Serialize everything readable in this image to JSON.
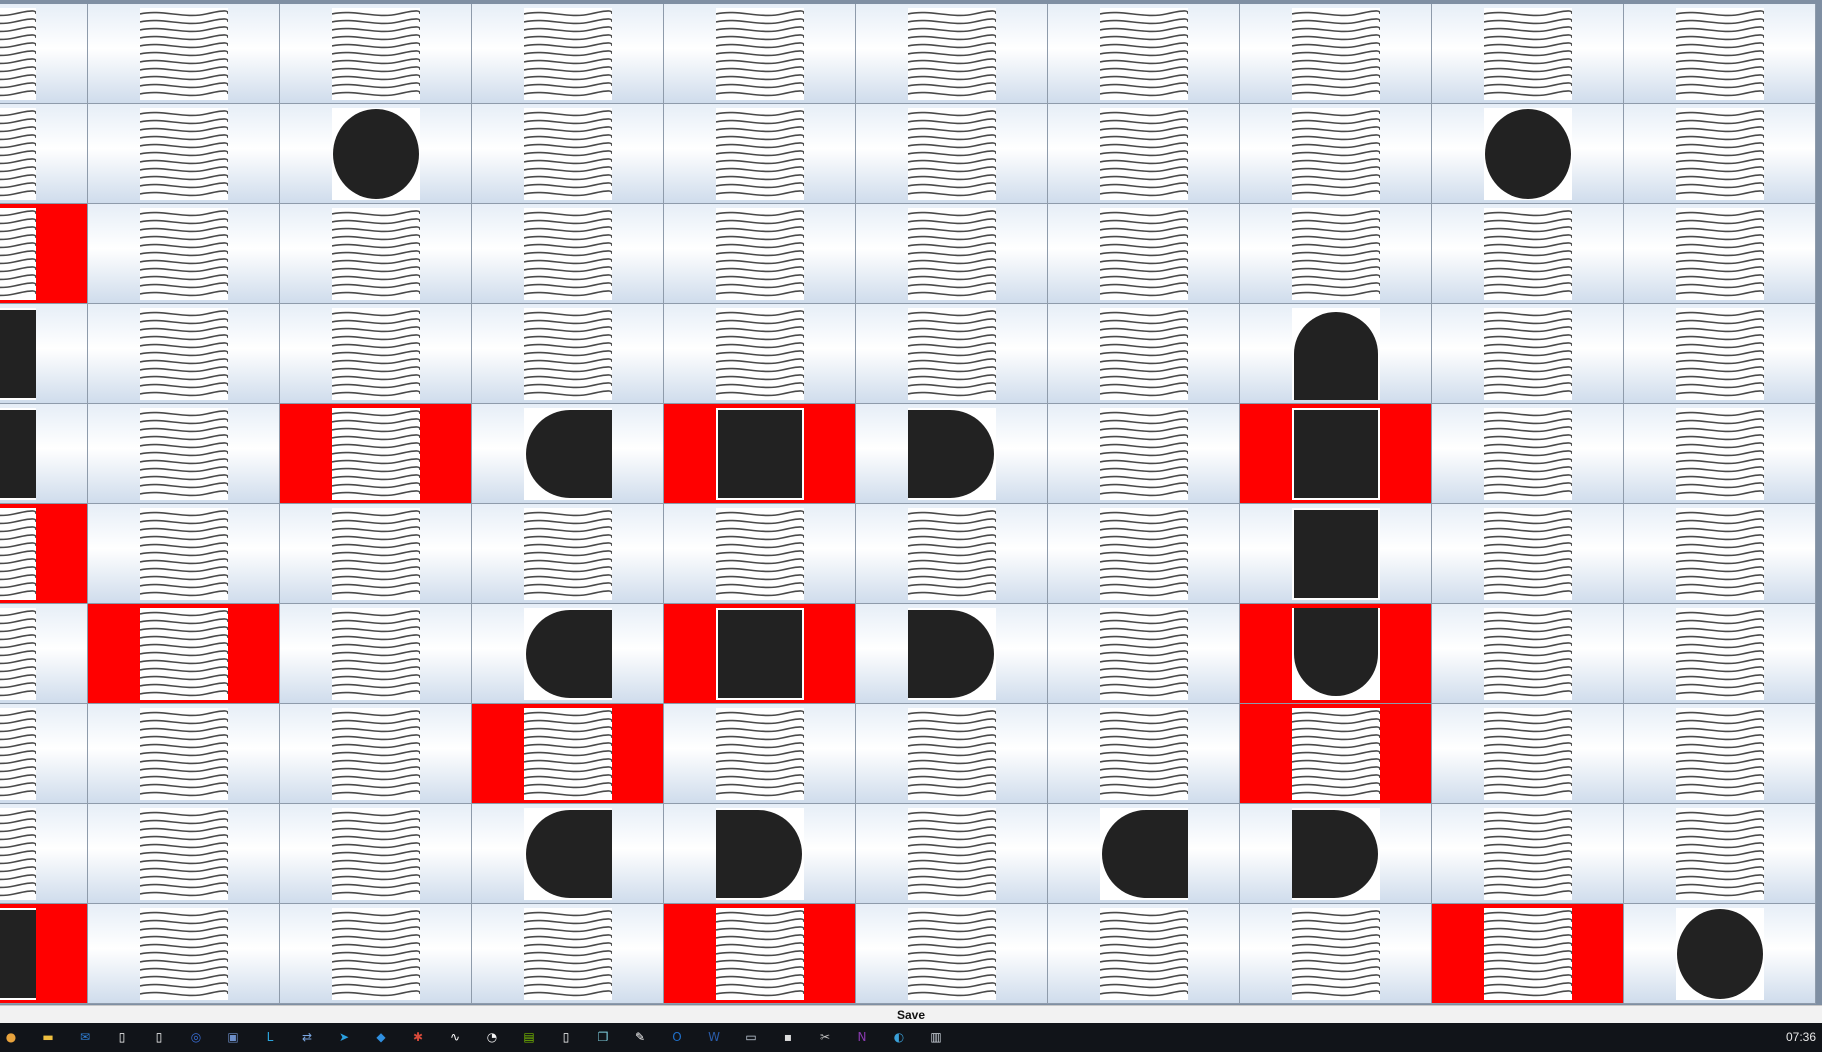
{
  "board": {
    "rows": [
      [
        {
          "t": "wave"
        },
        {
          "t": "wave"
        },
        {
          "t": "wave"
        },
        {
          "t": "wave"
        },
        {
          "t": "wave"
        },
        {
          "t": "wave"
        },
        {
          "t": "wave"
        },
        {
          "t": "wave"
        },
        {
          "t": "wave"
        },
        {
          "t": "wave"
        }
      ],
      [
        {
          "t": "wave"
        },
        {
          "t": "wave"
        },
        {
          "t": "circle"
        },
        {
          "t": "wave"
        },
        {
          "t": "wave"
        },
        {
          "t": "wave"
        },
        {
          "t": "wave"
        },
        {
          "t": "wave"
        },
        {
          "t": "circle"
        },
        {
          "t": "wave"
        }
      ],
      [
        {
          "t": "wave",
          "m": true
        },
        {
          "t": "wave"
        },
        {
          "t": "wave"
        },
        {
          "t": "wave"
        },
        {
          "t": "wave"
        },
        {
          "t": "wave"
        },
        {
          "t": "wave"
        },
        {
          "t": "wave"
        },
        {
          "t": "wave"
        },
        {
          "t": "wave"
        }
      ],
      [
        {
          "t": "cap-left"
        },
        {
          "t": "wave"
        },
        {
          "t": "wave"
        },
        {
          "t": "wave"
        },
        {
          "t": "wave"
        },
        {
          "t": "wave"
        },
        {
          "t": "wave"
        },
        {
          "t": "cap-up"
        },
        {
          "t": "wave"
        },
        {
          "t": "wave"
        }
      ],
      [
        {
          "t": "cap-left"
        },
        {
          "t": "wave"
        },
        {
          "t": "wave",
          "m": true
        },
        {
          "t": "cap-left"
        },
        {
          "t": "square",
          "m": true
        },
        {
          "t": "cap-right"
        },
        {
          "t": "wave"
        },
        {
          "t": "square",
          "m": true
        },
        {
          "t": "wave"
        },
        {
          "t": "wave"
        }
      ],
      [
        {
          "t": "wave",
          "m": true
        },
        {
          "t": "wave"
        },
        {
          "t": "wave"
        },
        {
          "t": "wave"
        },
        {
          "t": "wave"
        },
        {
          "t": "wave"
        },
        {
          "t": "wave"
        },
        {
          "t": "square"
        },
        {
          "t": "wave"
        },
        {
          "t": "wave"
        }
      ],
      [
        {
          "t": "wave"
        },
        {
          "t": "wave",
          "m": true
        },
        {
          "t": "wave"
        },
        {
          "t": "cap-left"
        },
        {
          "t": "square",
          "m": true
        },
        {
          "t": "cap-right"
        },
        {
          "t": "wave"
        },
        {
          "t": "cap-down",
          "m": true
        },
        {
          "t": "wave"
        },
        {
          "t": "wave"
        }
      ],
      [
        {
          "t": "wave"
        },
        {
          "t": "wave"
        },
        {
          "t": "wave"
        },
        {
          "t": "wave",
          "m": true
        },
        {
          "t": "wave"
        },
        {
          "t": "wave"
        },
        {
          "t": "wave"
        },
        {
          "t": "wave",
          "m": true
        },
        {
          "t": "wave"
        },
        {
          "t": "wave"
        }
      ],
      [
        {
          "t": "wave"
        },
        {
          "t": "wave"
        },
        {
          "t": "wave"
        },
        {
          "t": "cap-left"
        },
        {
          "t": "cap-right"
        },
        {
          "t": "wave"
        },
        {
          "t": "cap-left"
        },
        {
          "t": "cap-right"
        },
        {
          "t": "wave"
        },
        {
          "t": "wave"
        }
      ],
      [
        {
          "t": "cap-left",
          "m": true
        },
        {
          "t": "wave"
        },
        {
          "t": "wave"
        },
        {
          "t": "wave"
        },
        {
          "t": "wave",
          "m": true
        },
        {
          "t": "wave"
        },
        {
          "t": "wave"
        },
        {
          "t": "wave"
        },
        {
          "t": "wave",
          "m": true
        },
        {
          "t": "circle"
        }
      ]
    ]
  },
  "save_bar": {
    "label": "Save"
  },
  "taskbar": {
    "icons": [
      {
        "name": "chrome-icon",
        "color": "#e8a33d",
        "glyph": "●"
      },
      {
        "name": "file-explorer-icon",
        "color": "#f0c040",
        "glyph": "▬"
      },
      {
        "name": "mail-icon",
        "color": "#2f7fd6",
        "glyph": "✉"
      },
      {
        "name": "document-icon",
        "color": "#ffffff",
        "glyph": "▯"
      },
      {
        "name": "document-icon",
        "color": "#ffffff",
        "glyph": "▯"
      },
      {
        "name": "chat-icon",
        "color": "#3a6fd8",
        "glyph": "◎"
      },
      {
        "name": "remote-desktop-icon",
        "color": "#6d8fc9",
        "glyph": "▣"
      },
      {
        "name": "app-l-icon",
        "color": "#2aa4dc",
        "glyph": "L"
      },
      {
        "name": "network-icon",
        "color": "#7aa6e0",
        "glyph": "⇄"
      },
      {
        "name": "telegram-icon",
        "color": "#2aa0e0",
        "glyph": "➤"
      },
      {
        "name": "vscode-icon",
        "color": "#2f8fe0",
        "glyph": "◆"
      },
      {
        "name": "bug-icon",
        "color": "#d84a3a",
        "glyph": "✱"
      },
      {
        "name": "wave-app-icon",
        "color": "#ffffff",
        "glyph": "∿"
      },
      {
        "name": "clock-app-icon",
        "color": "#f5f5f5",
        "glyph": "◔"
      },
      {
        "name": "nvidia-icon",
        "color": "#76b900",
        "glyph": "▤"
      },
      {
        "name": "notepad-icon",
        "color": "#ffffff",
        "glyph": "▯"
      },
      {
        "name": "files-icon",
        "color": "#7fd0e0",
        "glyph": "❐"
      },
      {
        "name": "edit-icon",
        "color": "#ffffff",
        "glyph": "✎"
      },
      {
        "name": "outlook-icon",
        "color": "#1f6fc8",
        "glyph": "O"
      },
      {
        "name": "word-icon",
        "color": "#2a5caa",
        "glyph": "W"
      },
      {
        "name": "monitor-icon",
        "color": "#c8d2de",
        "glyph": "▭"
      },
      {
        "name": "terminal-icon",
        "color": "#dddddd",
        "glyph": "▪"
      },
      {
        "name": "snip-icon",
        "color": "#c0c0c0",
        "glyph": "✂"
      },
      {
        "name": "onenote-icon",
        "color": "#8a3ab0",
        "glyph": "N"
      },
      {
        "name": "edge-icon",
        "color": "#3aa0d8",
        "glyph": "◐"
      },
      {
        "name": "java-app-icon",
        "color": "#d0d6de",
        "glyph": "▥"
      }
    ],
    "clock": "07:36"
  },
  "colors": {
    "marked": "#ff0000",
    "shape": "#222222",
    "wave": "#4a4a4a"
  }
}
